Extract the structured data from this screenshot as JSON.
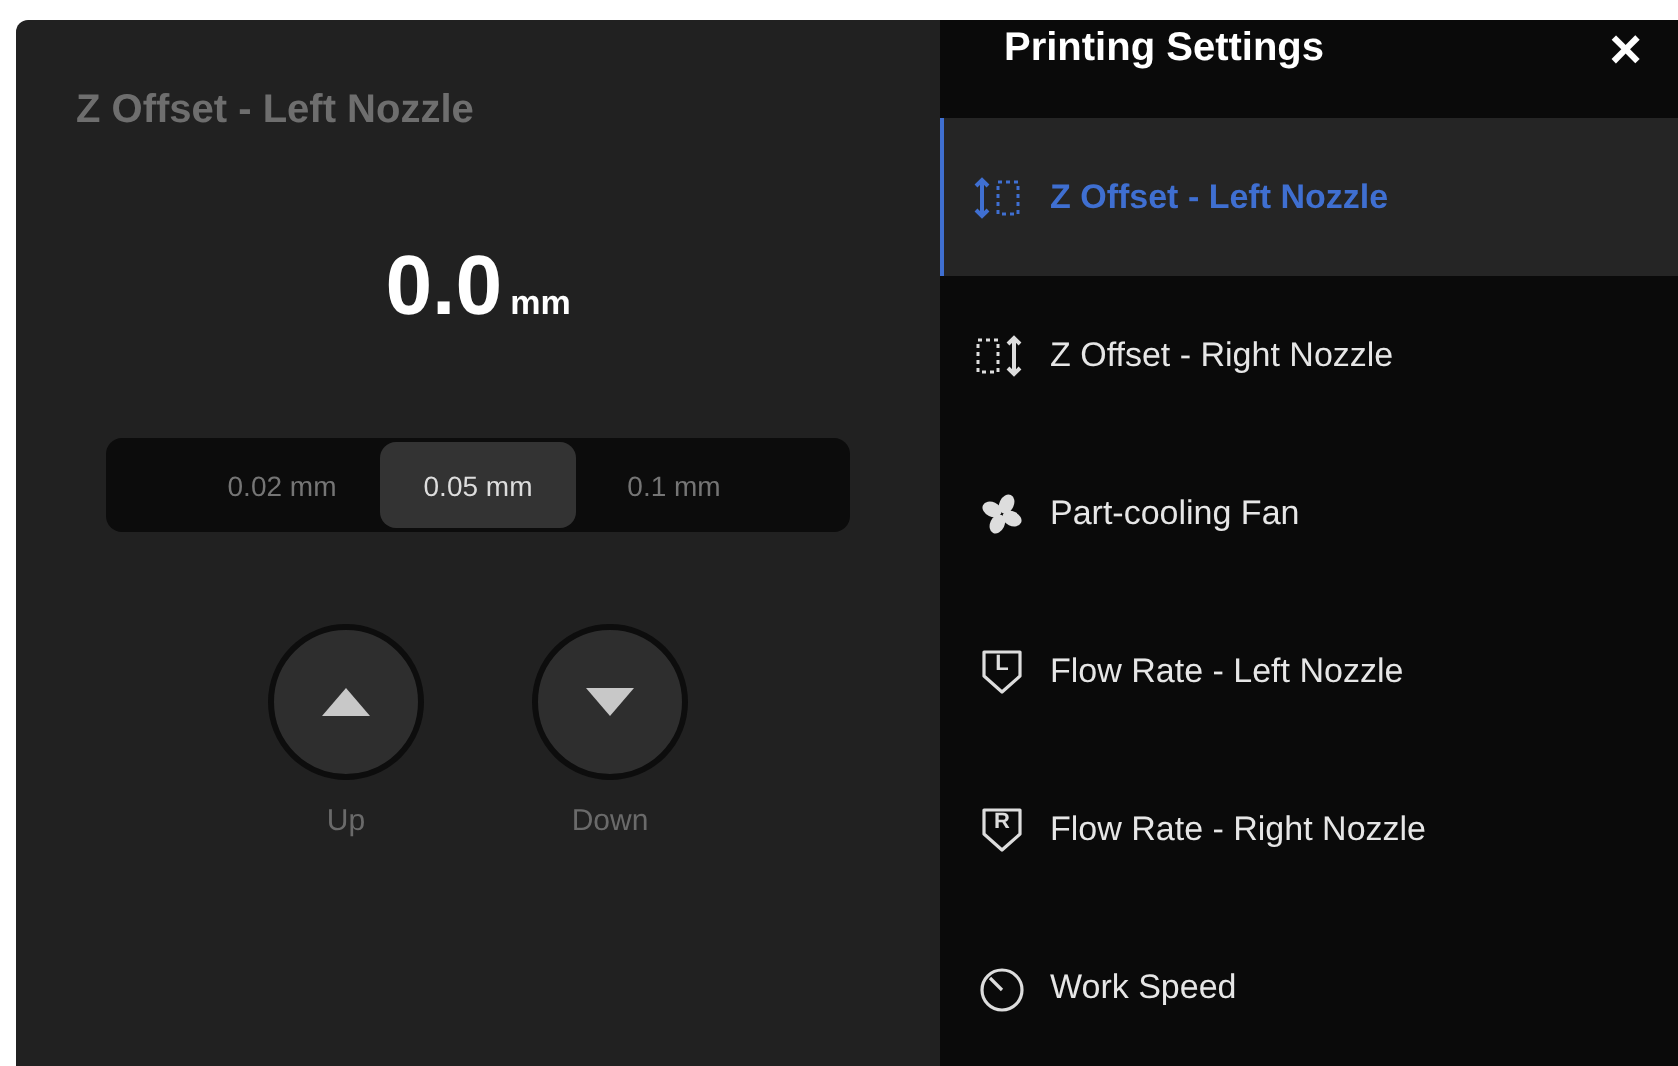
{
  "panel": {
    "title": "Z Offset - Left Nozzle",
    "value": "0.0",
    "unit": "mm",
    "steps": [
      {
        "label": "0.02 mm",
        "selected": false
      },
      {
        "label": "0.05 mm",
        "selected": true
      },
      {
        "label": "0.1 mm",
        "selected": false
      }
    ],
    "buttons": [
      {
        "kind": "up",
        "label": "Up"
      },
      {
        "kind": "down",
        "label": "Down"
      }
    ]
  },
  "sidebar": {
    "title": "Printing Settings",
    "close": "×",
    "items": [
      {
        "kind": "offset-left",
        "label": "Z Offset - Left Nozzle",
        "selected": true
      },
      {
        "kind": "offset-right",
        "label": "Z Offset - Right Nozzle",
        "selected": false
      },
      {
        "kind": "fan",
        "label": "Part-cooling Fan",
        "selected": false
      },
      {
        "kind": "flow",
        "badge": "L",
        "label": "Flow Rate - Left Nozzle",
        "selected": false
      },
      {
        "kind": "flow",
        "badge": "R",
        "label": "Flow Rate - Right Nozzle",
        "selected": false
      },
      {
        "kind": "speed",
        "label": "Work Speed",
        "selected": false
      }
    ]
  }
}
